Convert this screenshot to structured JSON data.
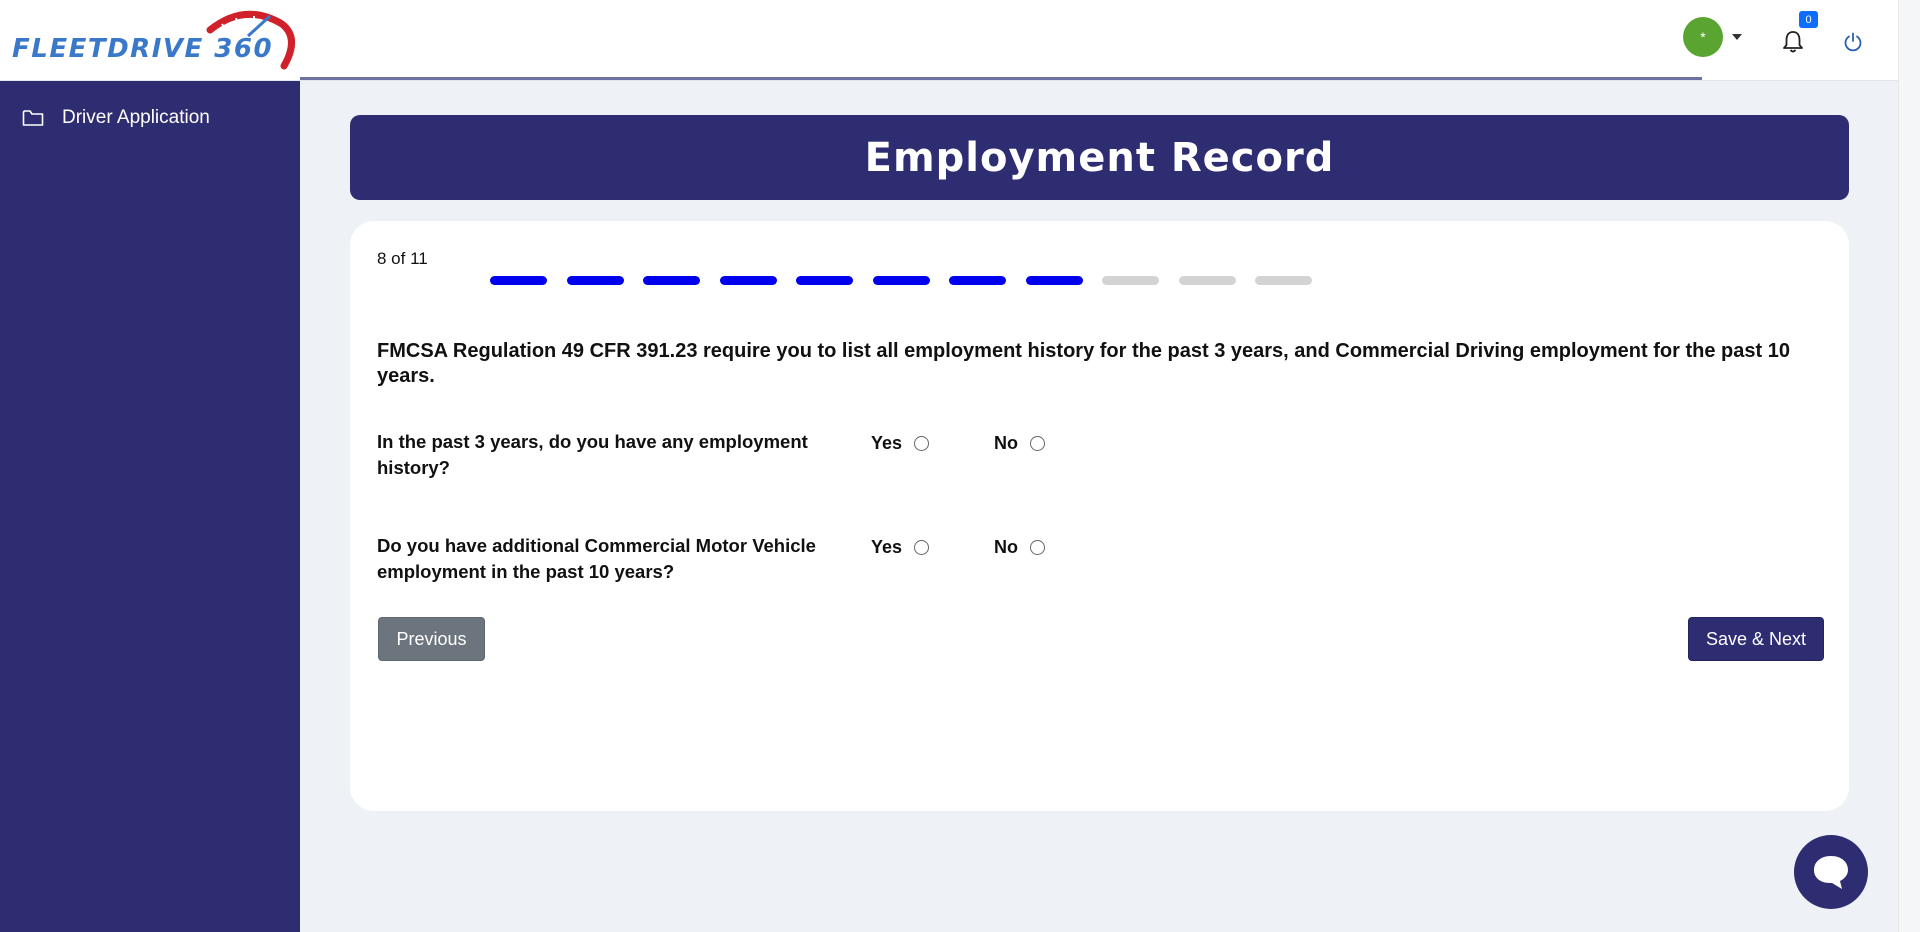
{
  "brand": {
    "logo_text": "FLEETDRIVE 360"
  },
  "header": {
    "avatar_label": "*",
    "notifications_count": "0",
    "icons": [
      "caret-down-icon",
      "bell-icon",
      "power-icon"
    ]
  },
  "sidebar": {
    "items": [
      {
        "label": "Driver Application",
        "icon": "folder-icon"
      }
    ]
  },
  "page": {
    "title": "Employment Record",
    "step_text": "8 of 11",
    "steps_total": 11,
    "steps_completed": 8,
    "intro": "FMCSA Regulation 49 CFR 391.23 require you to list all employment history for the past 3 years, and Commercial Driving employment for the past 10 years.",
    "questions": [
      {
        "text": "In the past 3 years, do you have any employment history?",
        "yes": "Yes",
        "no": "No"
      },
      {
        "text": "Do you have additional Commercial Motor Vehicle employment in the past 10 years?",
        "yes": "Yes",
        "no": "No"
      }
    ],
    "previous_label": "Previous",
    "next_label": "Save & Next"
  },
  "colors": {
    "brand_navy": "#2e2d72",
    "step_done": "#0000ee",
    "step_pending": "#d3d3d3",
    "avatar": "#5aa532",
    "badge": "#0d6efd",
    "previous_button": "#6c757d"
  }
}
